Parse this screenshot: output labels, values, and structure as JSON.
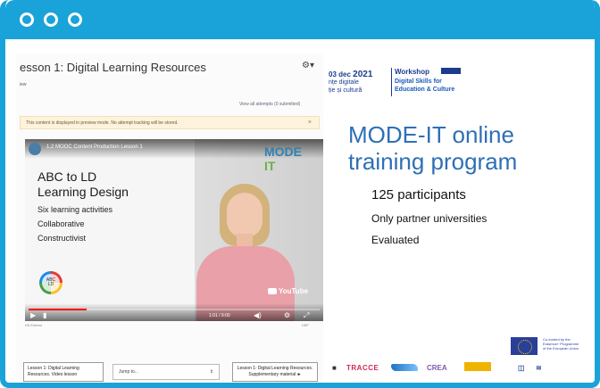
{
  "window": {
    "accent": "#1aa3d8"
  },
  "lms": {
    "lesson_title": "esson 1: Digital Learning Resources",
    "gear_icon": "⚙▾",
    "view_tab": "iew",
    "view_all_attempts": "View all attempts (0 submitted)",
    "notice": "This content is displayed in preview mode. No attempt tracking will be stored.",
    "notice_close": "×",
    "below_left": "H5 Embed",
    "below_right": "H5P",
    "nav_prev": "Lesson 1: Digital Learning Resources. Video lesson",
    "jump_label": "Jump to...",
    "jump_arrow": "⇕",
    "nav_next": "Lesson 1: Digital Learning Resources. Supplementary material ►"
  },
  "video": {
    "title": "1.2 MOOC Content Production Lesson 1",
    "brand_mode": "MODE",
    "brand_it": "IT",
    "abc_title_1": "ABC to LD",
    "abc_title_2": "Learning Design",
    "activities": [
      "Six learning activities",
      "Collaborative",
      "Constructivist"
    ],
    "abc_logo_text_1": "ABC",
    "abc_logo_text_2": "LD",
    "youtube": "YouTube",
    "time": "1:01 / 9:00",
    "progress": 0.2,
    "controls": {
      "play": "▶",
      "next": "▮",
      "volume": "◀)",
      "settings": "⚙",
      "fullscreen": "⤢"
    }
  },
  "slide": {
    "date_day": "03 dec",
    "date_year": "2021",
    "ro_line1": "nțe digitale",
    "ro_line2": "ție și cultură",
    "workshop": "Workshop",
    "en_line1": "Digital Skills for",
    "en_line2": "Education & Culture",
    "heading_1": "MODE-IT online",
    "heading_2": "training program",
    "bullets": [
      "125 participants",
      "Only partner universities",
      "Evaluated"
    ],
    "eu_text_1": "Co-funded by the",
    "eu_text_2": "Erasmus+ Programme",
    "eu_text_3": "of the European Union"
  },
  "partners": {
    "trace": "TRACCE",
    "crea": "CREA"
  }
}
